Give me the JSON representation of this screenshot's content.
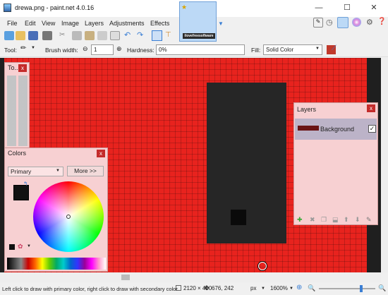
{
  "window": {
    "title": "drewa.png - paint.net 4.0.16",
    "minimize": "—",
    "maximize": "☐",
    "close": "✕"
  },
  "menus": [
    "File",
    "Edit",
    "View",
    "Image",
    "Layers",
    "Adjustments",
    "Effects"
  ],
  "image_tab": {
    "logo_text": "ilovefreesoftware"
  },
  "options_bar": {
    "tool_label": "Tool:",
    "brush_width_label": "Brush width:",
    "brush_width_value": "1",
    "hardness_label": "Hardness:",
    "hardness_value": "0%",
    "fill_label": "Fill:",
    "fill_value": "Solid Color"
  },
  "tools_panel": {
    "title": "To..."
  },
  "colors_panel": {
    "title": "Colors",
    "mode": "Primary",
    "more_button": "More >>"
  },
  "layers_panel": {
    "title": "Layers",
    "layer_name": "Background"
  },
  "status": {
    "hint": "Left click to draw with primary color, right click to draw with secondary color.",
    "image_size": "2120 × 400",
    "cursor_pos": "676, 242",
    "units": "px",
    "zoom": "1600%"
  },
  "colors": {
    "canvas_red": "#e8231e",
    "dark": "#262626",
    "panel_bg": "#f7d0d2",
    "accent": "#bcd9f6"
  }
}
